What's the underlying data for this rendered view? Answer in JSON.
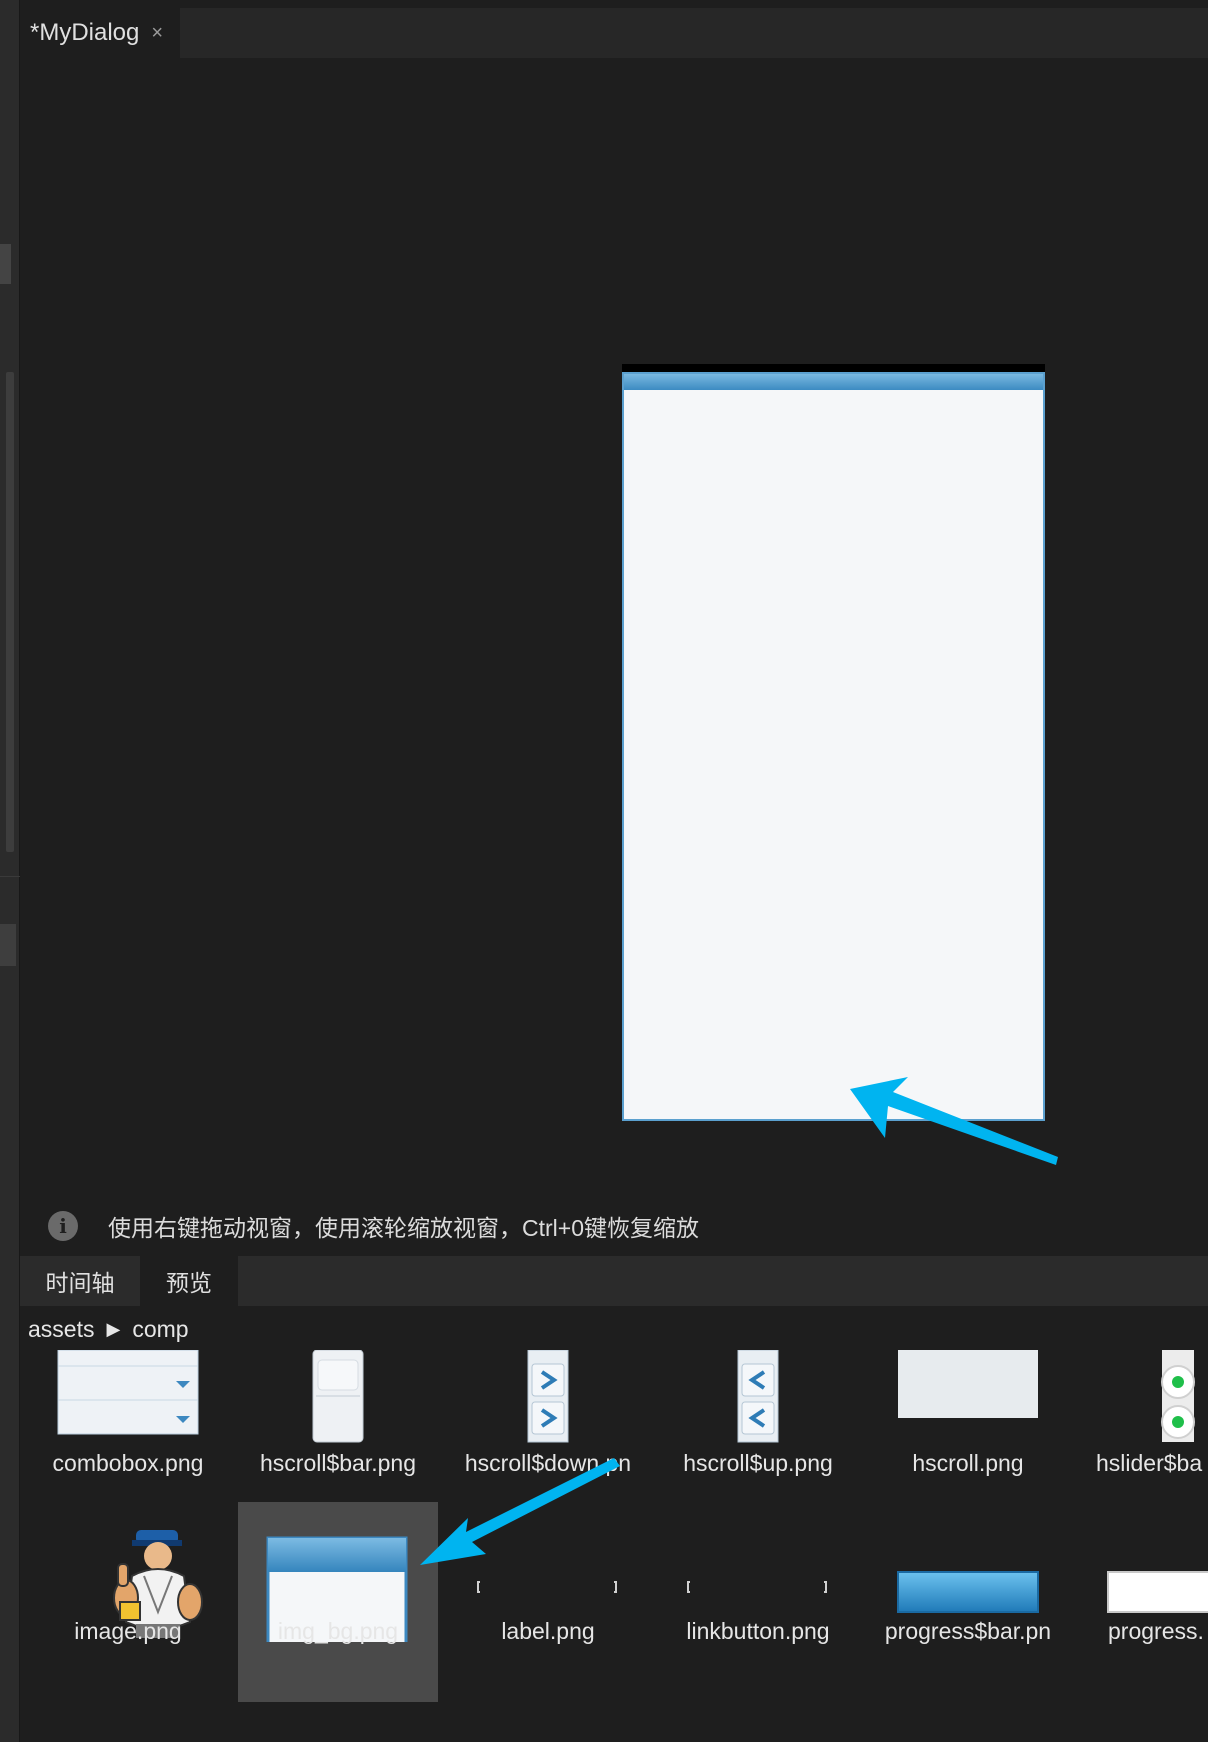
{
  "editor": {
    "tab_title": "*MyDialog",
    "tab_close": "×"
  },
  "hint": {
    "icon": "info-icon",
    "text": "使用右键拖动视窗，使用滚轮缩放视窗，Ctrl+0键恢复缩放"
  },
  "panel": {
    "tabs": [
      "时间轴",
      "预览"
    ]
  },
  "breadcrumb": {
    "root": "assets",
    "separator": "▶",
    "current": "comp"
  },
  "assets": [
    {
      "label": "combobox.png"
    },
    {
      "label": "hscroll$bar.png"
    },
    {
      "label": "hscroll$down.pn"
    },
    {
      "label": "hscroll$up.png"
    },
    {
      "label": "hscroll.png"
    },
    {
      "label": "hslider$ba"
    },
    {
      "label": "image.png"
    },
    {
      "label": "img_bg.png"
    },
    {
      "label": "label.png"
    },
    {
      "label": "linkbutton.png"
    },
    {
      "label": "progress$bar.pn"
    },
    {
      "label": "progress."
    }
  ],
  "colors": {
    "background": "#1e1e1e",
    "accent_arrow": "#00b4f0",
    "dialog_title": "#4b9ad0",
    "selection": "#4a4a4a"
  }
}
